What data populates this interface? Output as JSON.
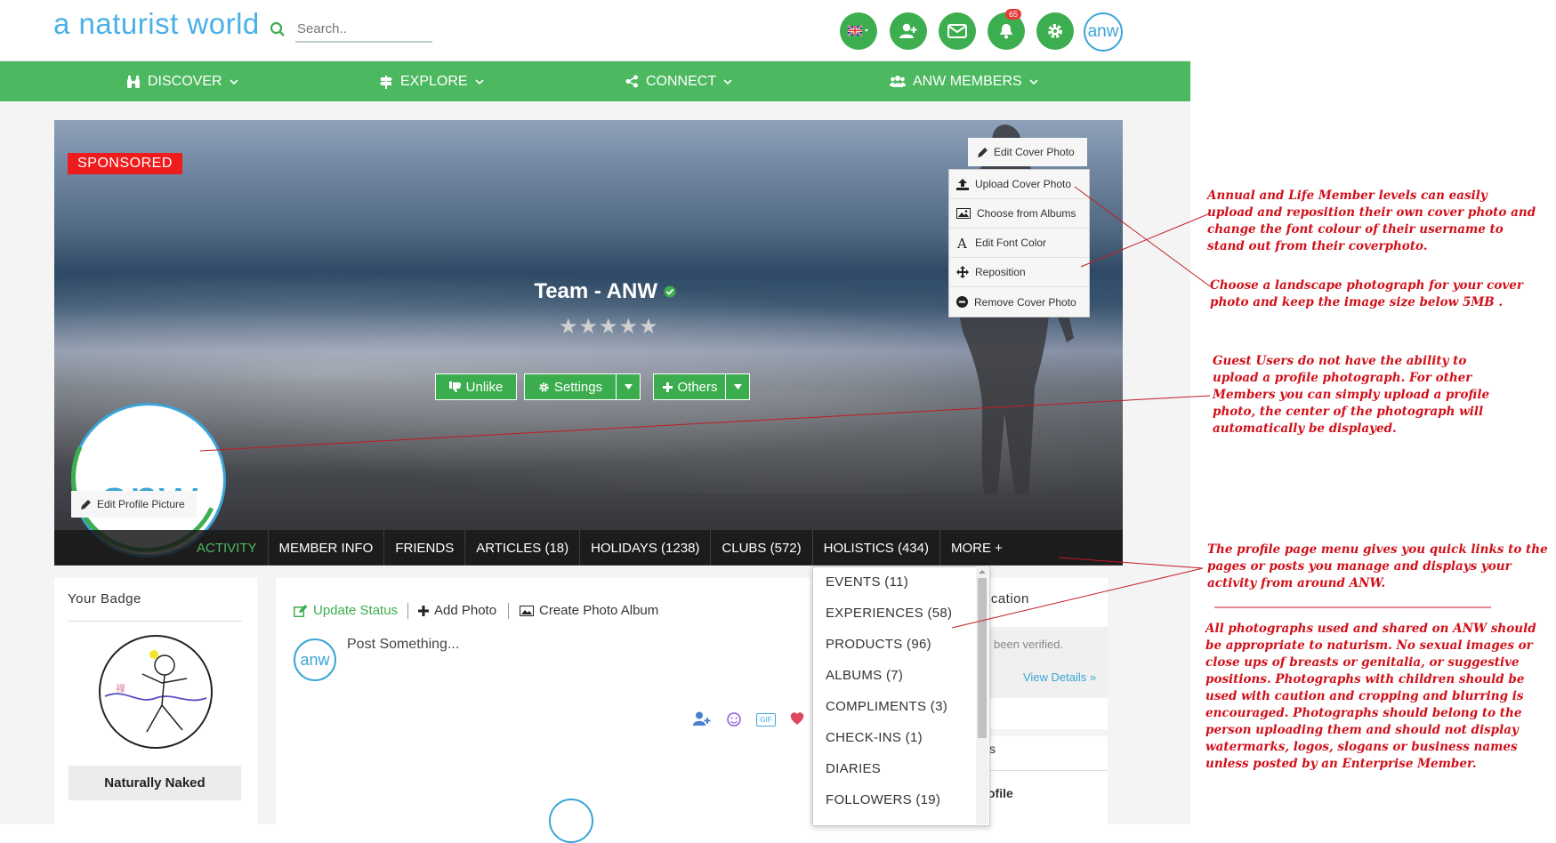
{
  "header": {
    "logo_a": "a naturist",
    "logo_b": "world",
    "search_placeholder": "Search..",
    "notification_count": "65",
    "avatar_text": "anw"
  },
  "nav": {
    "discover": "DISCOVER",
    "explore": "EXPLORE",
    "connect": "CONNECT",
    "members": "ANW MEMBERS"
  },
  "cover": {
    "sponsored": "SPONSORED",
    "username": "Team - ANW",
    "stars": "★★★★★",
    "unlike": "Unlike",
    "settings": "Settings",
    "others": "Others",
    "edit_cover": "Edit Cover Photo",
    "menu": [
      "Upload Cover Photo",
      "Choose from Albums",
      "Edit Font Color",
      "Reposition",
      "Remove Cover Photo"
    ],
    "edit_profile_picture": "Edit Profile Picture",
    "profile_text": "anw"
  },
  "tabs": [
    "ACTIVITY",
    "MEMBER INFO",
    "FRIENDS",
    "ARTICLES (18)",
    "HOLIDAYS (1238)",
    "CLUBS (572)",
    "HOLISTICS (434)",
    "MORE +"
  ],
  "more_menu": [
    "EVENTS (11)",
    "EXPERIENCES (58)",
    "PRODUCTS (96)",
    "ALBUMS (7)",
    "COMPLIMENTS (3)",
    "CHECK-INS (1)",
    "DIARIES",
    "FOLLOWERS (19)"
  ],
  "badge": {
    "title": "Your Badge",
    "name": "Naturally Naked"
  },
  "post": {
    "update_status": "Update Status",
    "add_photo": "Add Photo",
    "create_album": "Create Photo Album",
    "placeholder": "Post Something...",
    "avatar_text": "anw",
    "gif": "GIF"
  },
  "right": {
    "heading_frag": "ication",
    "verified_frag": "been verified.",
    "view_details": "View Details »",
    "frag2": "s",
    "frag3": "ofile"
  },
  "annotations": [
    "Annual and Life Member levels can easily upload and reposition their own cover photo and change the font colour of their username to stand out from their coverphoto.",
    "Choose a landscape photograph for your cover photo and keep the image size below 5MB .",
    "Guest Users do not have the ability to upload a profile photograph. For other Members you can simply upload a profile photo, the center of the photograph will automatically be displayed.",
    "The profile page menu gives you quick links to the pages or posts you manage and displays your activity from around ANW.",
    "All photographs used and shared on ANW should be appropriate to naturism. No sexual images or close ups of breasts or genitalia, or suggestive positions. Photographs with children should be used with caution and cropping and blurring is encouraged. Photographs should belong to the person uploading them and should not display watermarks, logos, slogans or business names unless posted by an Enterprise Member."
  ],
  "colors": {
    "green": "#4cb860",
    "blue": "#3ba4d8",
    "red": "#d0101a"
  }
}
